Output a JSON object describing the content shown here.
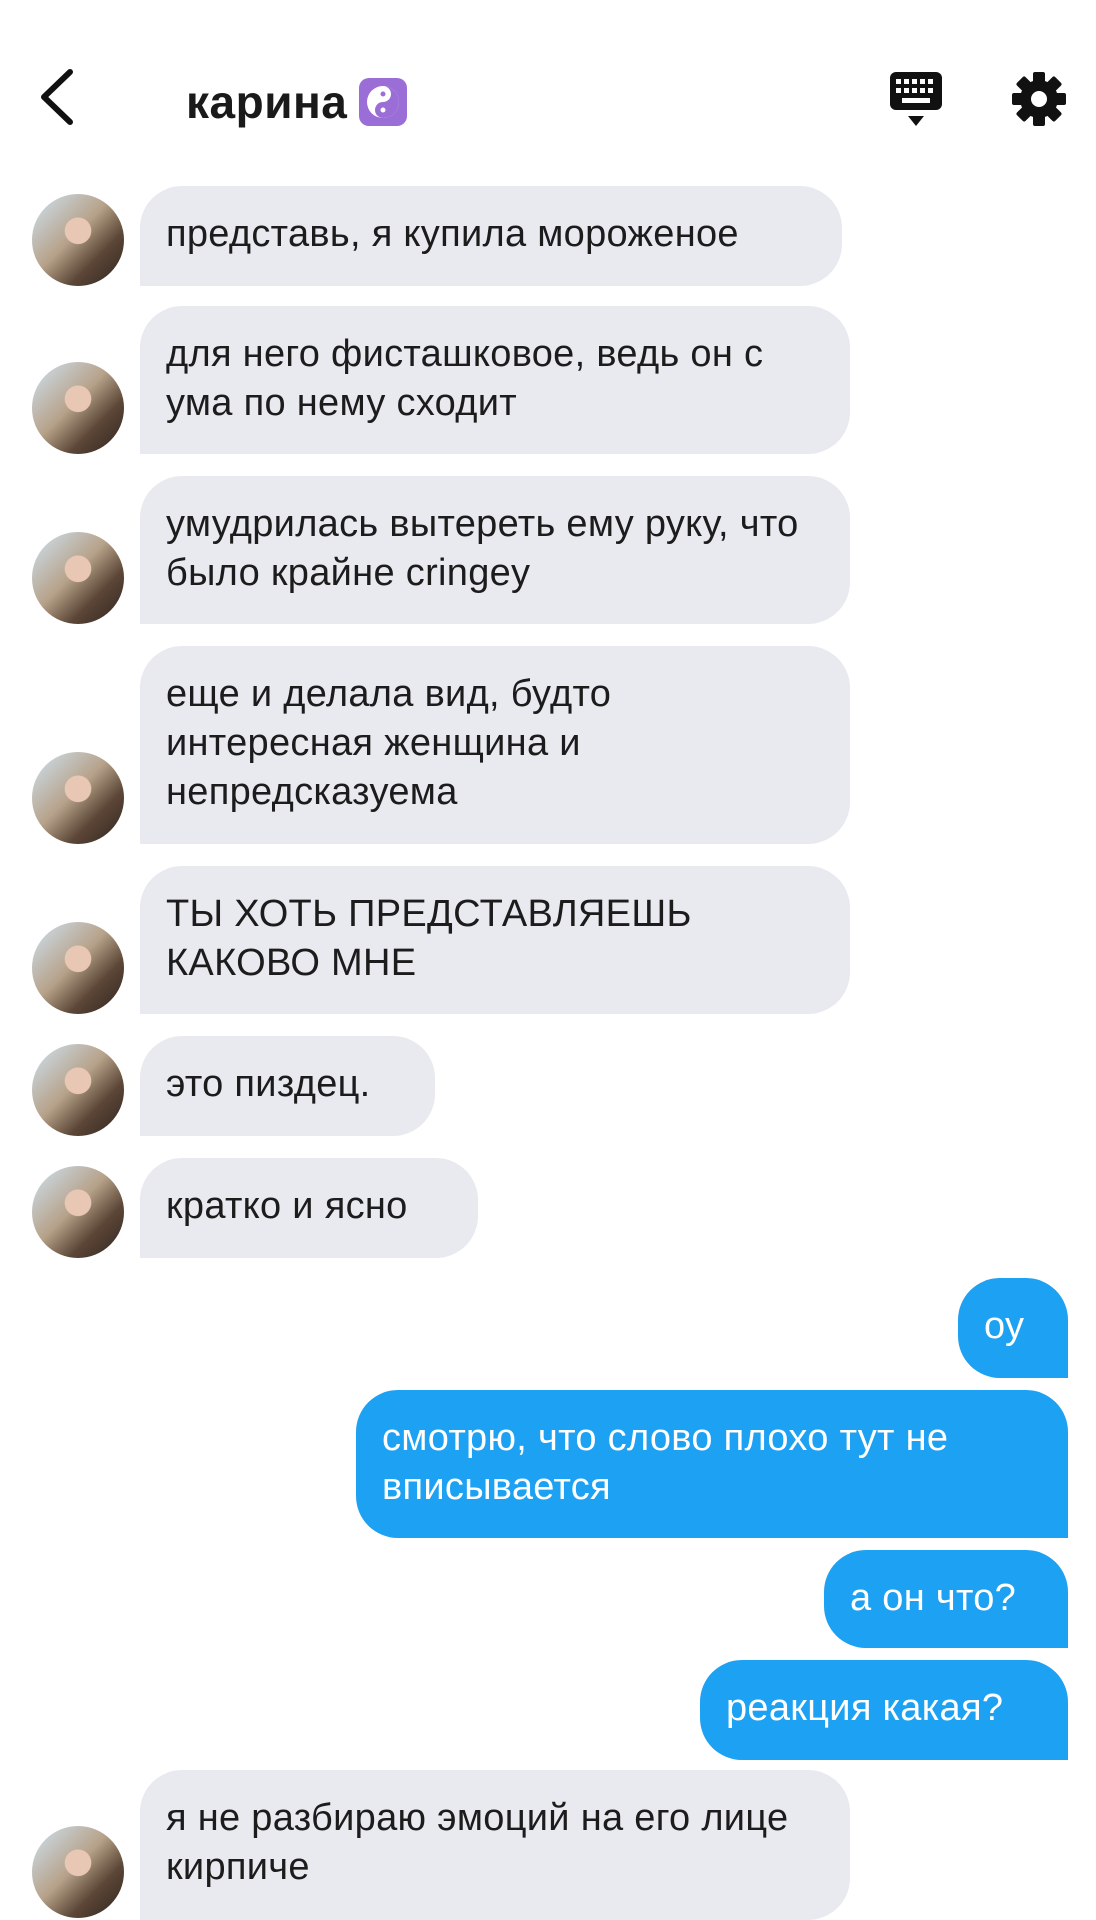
{
  "header": {
    "contact_name": "карина",
    "emoji_icon": "yin-yang-icon",
    "accent": "#9b6dd6"
  },
  "colors": {
    "incoming_bubble": "#e9eaf0",
    "outgoing_bubble": "#1da1f2"
  },
  "messages": [
    {
      "direction": "incoming",
      "text": "представь, я купила мороженое"
    },
    {
      "direction": "incoming",
      "text": "для него фисташковое, ведь он с ума по нему сходит"
    },
    {
      "direction": "incoming",
      "text": "умудрилась вытереть ему руку, что было крайне cringey"
    },
    {
      "direction": "incoming",
      "text": "еще и делала вид, будто интересная женщина и непредсказуема"
    },
    {
      "direction": "incoming",
      "text": "ТЫ ХОТЬ ПРЕДСТАВЛЯЕШЬ КАКОВО МНЕ"
    },
    {
      "direction": "incoming",
      "text": "это пиздец."
    },
    {
      "direction": "incoming",
      "text": "кратко и ясно"
    },
    {
      "direction": "outgoing",
      "text": "оу"
    },
    {
      "direction": "outgoing",
      "text": "смотрю, что слово плохо тут не вписывается"
    },
    {
      "direction": "outgoing",
      "text": "а он что?"
    },
    {
      "direction": "outgoing",
      "text": "реакция какая?"
    },
    {
      "direction": "incoming",
      "text": "я не разбираю эмоций на его лице кирпиче"
    }
  ]
}
